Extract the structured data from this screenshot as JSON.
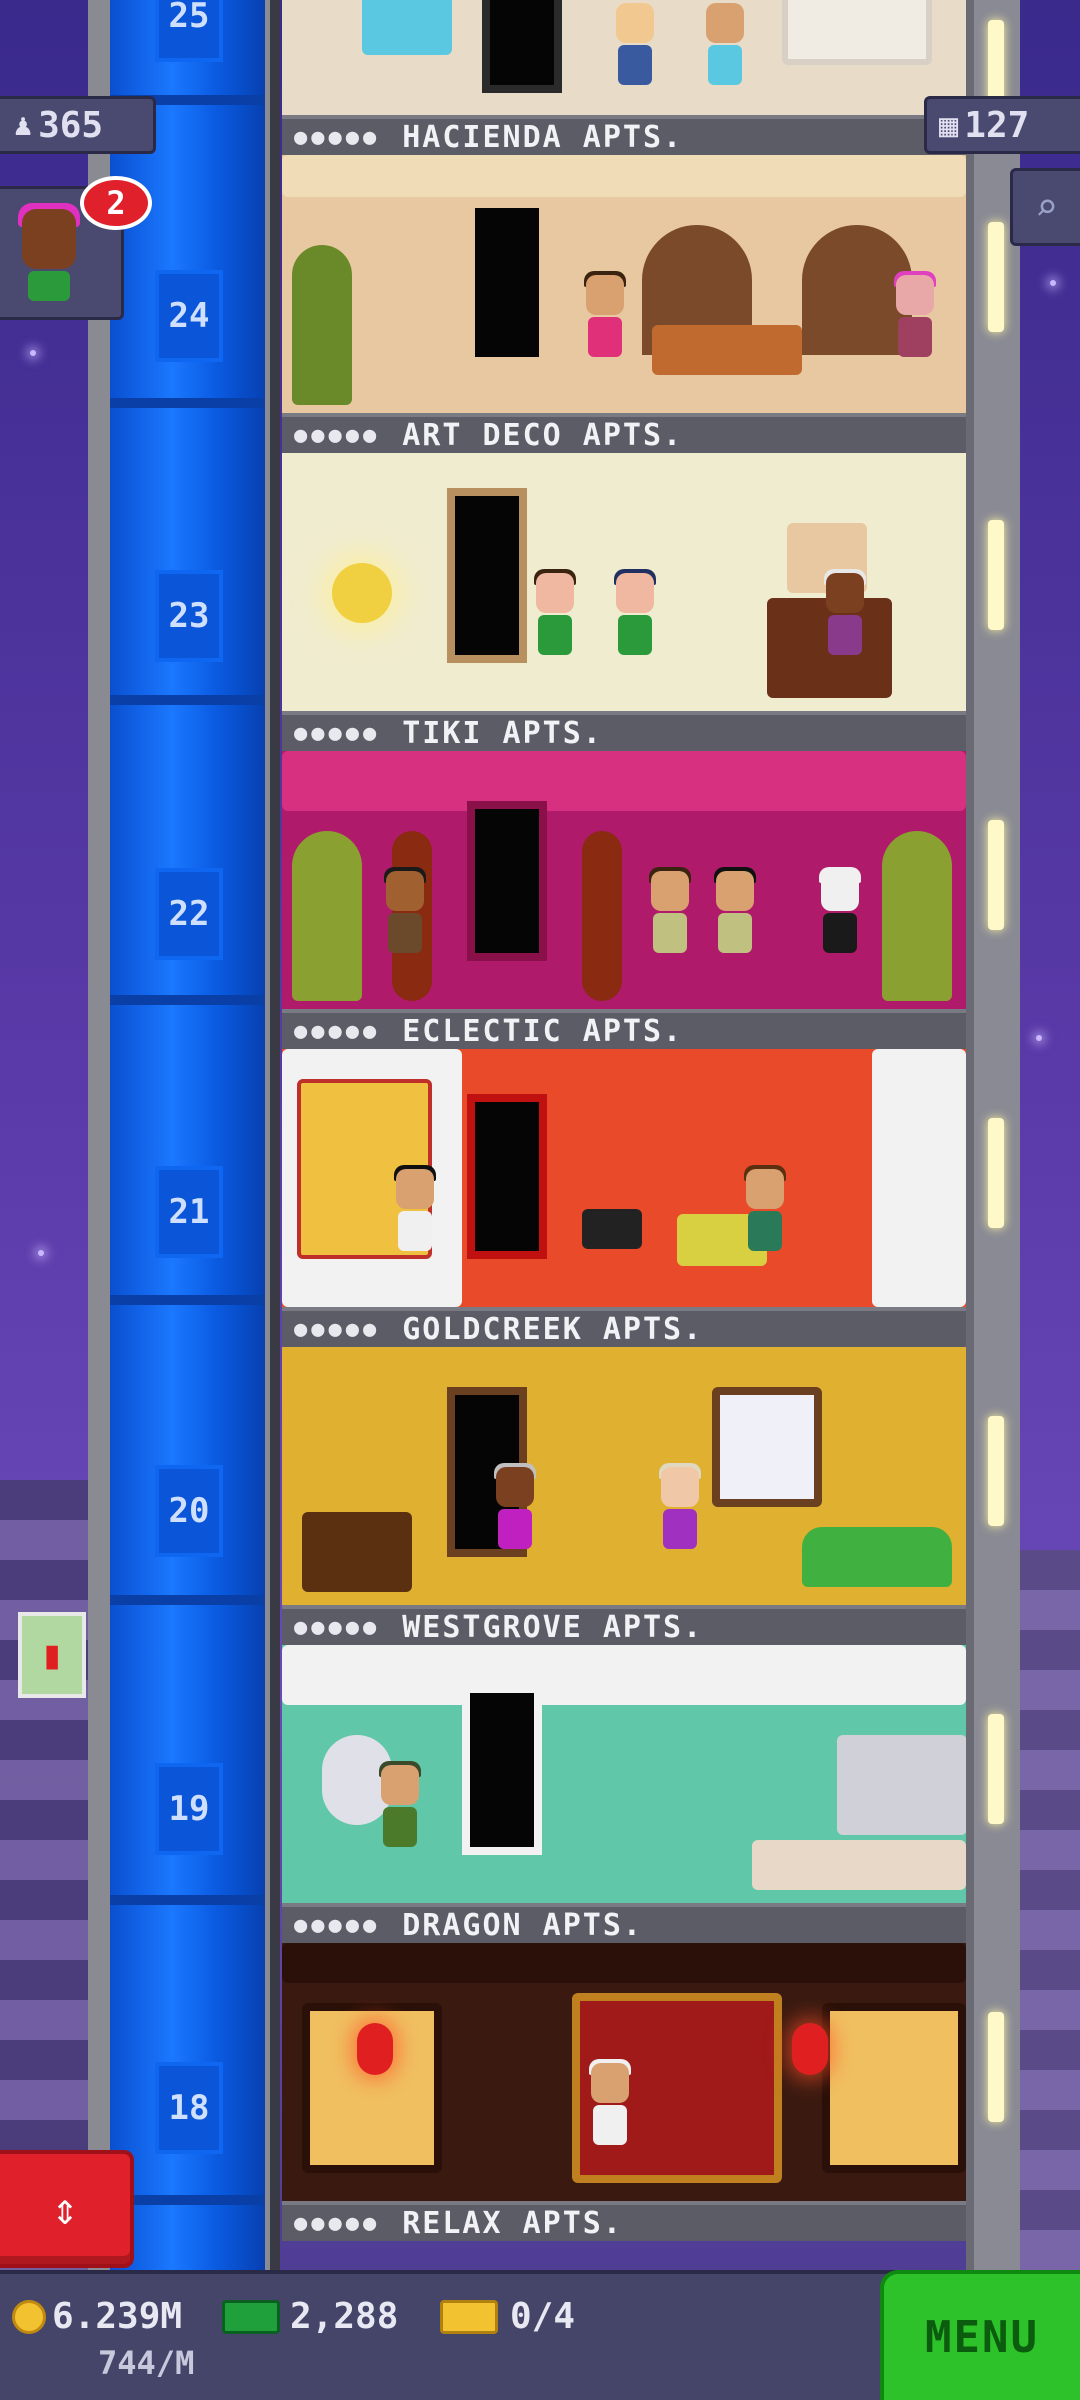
{
  "hud": {
    "population": "365",
    "floor_count": "127",
    "visitor_badge": "2"
  },
  "floors": [
    {
      "number": "25",
      "name": "HACIENDA APTS.",
      "stars": "●●●●●"
    },
    {
      "number": "24",
      "name": "ART DECO APTS.",
      "stars": "●●●●●"
    },
    {
      "number": "23",
      "name": "TIKI APTS.",
      "stars": "●●●●●"
    },
    {
      "number": "22",
      "name": "ECLECTIC APTS.",
      "stars": "●●●●●"
    },
    {
      "number": "21",
      "name": "GOLDCREEK APTS.",
      "stars": "●●●●●"
    },
    {
      "number": "20",
      "name": "WESTGROVE APTS.",
      "stars": "●●●●●"
    },
    {
      "number": "19",
      "name": "DRAGON APTS.",
      "stars": "●●●●●"
    },
    {
      "number": "18",
      "name": "RELAX APTS.",
      "stars": "●●●●●"
    }
  ],
  "bottom": {
    "coins": "6.239M",
    "rate": "744/M",
    "bux": "2,288",
    "tickets": "0/4",
    "menu_label": "MENU"
  },
  "colors": {
    "room_24": "#e8c8a0",
    "room_23": "#f0ecd0",
    "room_22": "#b01a6a",
    "room_21": "#e84a2a",
    "room_20": "#e0b030",
    "room_19": "#60c8a8",
    "room_18": "#3a1a10"
  }
}
